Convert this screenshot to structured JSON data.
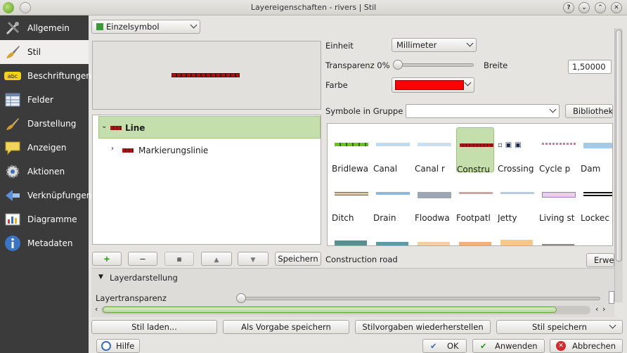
{
  "window": {
    "title": "Layereigenschaften - rivers | Stil",
    "help_glyph": "?",
    "min_glyph": "⌄",
    "max_glyph": "⌃",
    "close_glyph": "✕"
  },
  "sidebar": {
    "items": [
      {
        "label": "Allgemein",
        "icon": "tools-icon"
      },
      {
        "label": "Stil",
        "icon": "brush-icon"
      },
      {
        "label": "Beschriftungen",
        "icon": "abc-label-icon"
      },
      {
        "label": "Felder",
        "icon": "table-icon"
      },
      {
        "label": "Darstellung",
        "icon": "paintbrush-icon"
      },
      {
        "label": "Anzeigen",
        "icon": "speech-bubble-icon"
      },
      {
        "label": "Aktionen",
        "icon": "gear-icon"
      },
      {
        "label": "Verknüpfungen",
        "icon": "join-icon"
      },
      {
        "label": "Diagramme",
        "icon": "chart-icon"
      },
      {
        "label": "Metadaten",
        "icon": "info-icon"
      }
    ],
    "active_index": 1
  },
  "renderer": {
    "selected": "Einzelsymbol"
  },
  "tree": {
    "root": "Line",
    "child": "Markierungslinie"
  },
  "props": {
    "einheit_label": "Einheit",
    "einheit_value": "Millimeter",
    "transparenz_label": "Transparenz 0%",
    "breite_label": "Breite",
    "breite_value": "1,50000",
    "farbe_label": "Farbe",
    "farbe_color": "#ff0000"
  },
  "group": {
    "label": "Symbole in Gruppe",
    "value": "",
    "bibliothek": "Bibliothek"
  },
  "symbols": {
    "row1": [
      "Bridlewa",
      "Canal",
      "Canal r",
      "Constru",
      "Crossing",
      "Cycle p",
      "Dam"
    ],
    "row2": [
      "Ditch",
      "Drain",
      "Floodwa",
      "Footpatl",
      "Jetty",
      "Living st",
      "Lockec"
    ]
  },
  "symbol_buttons": {
    "save": "Speichern",
    "add": "+",
    "remove": "−",
    "up": "▲",
    "down": "▼"
  },
  "selected_symbol": {
    "name": "Construction road",
    "erw": "Erwe"
  },
  "layer_render": {
    "header": "Layerdarstellung",
    "transparency_label": "Layertransparenz"
  },
  "style_buttons": {
    "load": "Stil laden...",
    "save_default": "Als Vorgabe speichern",
    "restore": "Stilvorgaben wiederherstellen",
    "save": "Stil speichern"
  },
  "footer": {
    "help": "Hilfe",
    "ok": "OK",
    "apply": "Anwenden",
    "cancel": "Abbrechen"
  },
  "colors": {
    "sidebar_bg": "#3b3b3b",
    "accent_green": "#c4dfab",
    "symbol_red": "#cc1a1a"
  }
}
